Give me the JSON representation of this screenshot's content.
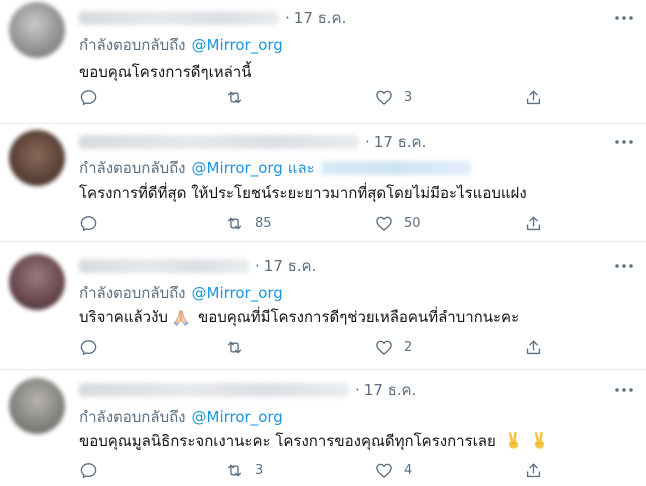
{
  "reply_prefix": "กำลังตอบกลับถึง",
  "and_label": "และ",
  "tweets": [
    {
      "date": "17 ธ.ค.",
      "mention": "@Mirror_org",
      "text": "ขอบคุณโครงการดีๆเหล่านี้",
      "retweets": "",
      "likes": "3"
    },
    {
      "date": "17 ธ.ค.",
      "mention": "@Mirror_org",
      "text": "โครงการที่ดีที่สุด ให้ประโยชน์ระยะยาวมากที่สุดโดยไม่มีอะไรแอบแฝง",
      "retweets": "85",
      "likes": "50"
    },
    {
      "date": "17 ธ.ค.",
      "mention": "@Mirror_org",
      "text_before_emoji": "บริจาคแล้วงับ",
      "text_after_emoji": "ขอบคุณที่มีโครงการดีๆช่วยเหลือคนที่ลำบากนะคะ",
      "retweets": "",
      "likes": "2"
    },
    {
      "date": "17 ธ.ค.",
      "mention": "@Mirror_org",
      "text": "ขอบคุณมูลนิธิกระจกเงานะคะ โครงการของคุณดีทุกโครงการเลย",
      "retweets": "3",
      "likes": "4"
    }
  ]
}
